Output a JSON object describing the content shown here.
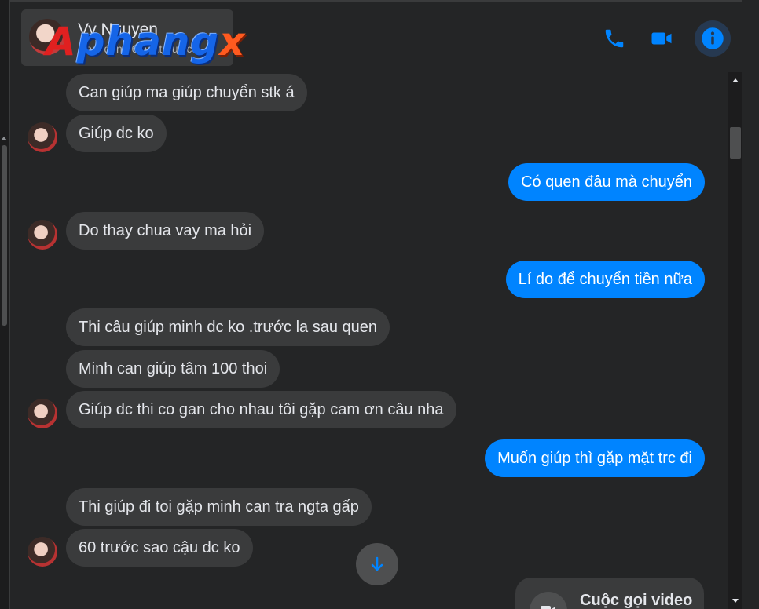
{
  "contact": {
    "name": "Vy Nguyen",
    "status": "Hoạt động 6 phút trước"
  },
  "watermark": {
    "text_a": "A",
    "text_main": "phang",
    "text_x": "x"
  },
  "header_actions": {
    "call_icon": "phone-icon",
    "video_icon": "video-camera-icon",
    "info_icon": "info-icon",
    "accent": "#0084ff"
  },
  "messages": [
    {
      "dir": "in",
      "text": "Can giúp ma giúp chuyển stk á"
    },
    {
      "dir": "in",
      "text": "Giúp dc ko"
    },
    {
      "dir": "out",
      "text": "Có quen đâu mà chuyển"
    },
    {
      "dir": "in",
      "text": "Do thay chua vay ma hỏi"
    },
    {
      "dir": "out",
      "text": "Lí do để chuyển tiền nữa"
    },
    {
      "dir": "in",
      "text": "Thi câu giúp minh dc ko .trước la sau quen"
    },
    {
      "dir": "in",
      "text": "Minh can giúp tâm 100 thoi"
    },
    {
      "dir": "in",
      "text": "Giúp dc thi co gan cho nhau tôi gặp cam ơn câu nha"
    },
    {
      "dir": "out",
      "text": "Muốn giúp thì gặp mặt trc đi"
    },
    {
      "dir": "in",
      "text": "Thi giúp đi toi gặp minh can tra ngta gấp"
    },
    {
      "dir": "in",
      "text": "60 trước sao cậu dc ko"
    }
  ],
  "call_card": {
    "label": "Cuộc gọi video",
    "icon": "video-camera-icon"
  },
  "scroll_down_icon": "arrow-down-icon"
}
